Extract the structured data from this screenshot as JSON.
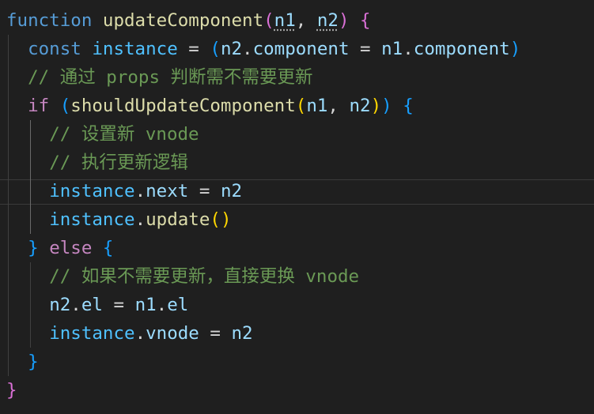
{
  "editor": {
    "background": "#1f1f1f",
    "lines": [
      [
        {
          "t": "function",
          "c": "kw"
        },
        {
          "t": " ",
          "c": "op"
        },
        {
          "t": "updateComponent",
          "c": "fn"
        },
        {
          "t": "(",
          "c": "b2"
        },
        {
          "t": "n1",
          "c": "var unused"
        },
        {
          "t": ", ",
          "c": "op"
        },
        {
          "t": "n2",
          "c": "var unused"
        },
        {
          "t": ")",
          "c": "b2"
        },
        {
          "t": " ",
          "c": "op"
        },
        {
          "t": "{",
          "c": "b2"
        }
      ],
      [
        {
          "t": "  ",
          "c": "op"
        },
        {
          "t": "const",
          "c": "kw"
        },
        {
          "t": " ",
          "c": "op"
        },
        {
          "t": "instance",
          "c": "cst"
        },
        {
          "t": " = ",
          "c": "op"
        },
        {
          "t": "(",
          "c": "b3"
        },
        {
          "t": "n2",
          "c": "var"
        },
        {
          "t": ".",
          "c": "op"
        },
        {
          "t": "component",
          "c": "var"
        },
        {
          "t": " = ",
          "c": "op"
        },
        {
          "t": "n1",
          "c": "var"
        },
        {
          "t": ".",
          "c": "op"
        },
        {
          "t": "component",
          "c": "var"
        },
        {
          "t": ")",
          "c": "b3"
        }
      ],
      [
        {
          "t": "  ",
          "c": "op"
        },
        {
          "t": "// 通过 props 判断需不需要更新",
          "c": "cm"
        }
      ],
      [
        {
          "t": "  ",
          "c": "op"
        },
        {
          "t": "if",
          "c": "ctl"
        },
        {
          "t": " ",
          "c": "op"
        },
        {
          "t": "(",
          "c": "b3"
        },
        {
          "t": "shouldUpdateComponent",
          "c": "fn"
        },
        {
          "t": "(",
          "c": "b1"
        },
        {
          "t": "n1",
          "c": "var"
        },
        {
          "t": ", ",
          "c": "op"
        },
        {
          "t": "n2",
          "c": "var"
        },
        {
          "t": ")",
          "c": "b1"
        },
        {
          "t": ")",
          "c": "b3"
        },
        {
          "t": " ",
          "c": "op"
        },
        {
          "t": "{",
          "c": "b3"
        }
      ],
      [
        {
          "t": "    ",
          "c": "op"
        },
        {
          "t": "// 设置新 vnode",
          "c": "cm"
        }
      ],
      [
        {
          "t": "    ",
          "c": "op"
        },
        {
          "t": "// 执行更新逻辑",
          "c": "cm"
        }
      ],
      [
        {
          "t": "    ",
          "c": "op"
        },
        {
          "t": "instance",
          "c": "cst"
        },
        {
          "t": ".",
          "c": "op"
        },
        {
          "t": "next",
          "c": "var"
        },
        {
          "t": " = ",
          "c": "op"
        },
        {
          "t": "n2",
          "c": "var"
        }
      ],
      [
        {
          "t": "    ",
          "c": "op"
        },
        {
          "t": "instance",
          "c": "cst"
        },
        {
          "t": ".",
          "c": "op"
        },
        {
          "t": "update",
          "c": "fn"
        },
        {
          "t": "(",
          "c": "b1"
        },
        {
          "t": ")",
          "c": "b1"
        }
      ],
      [
        {
          "t": "  ",
          "c": "op"
        },
        {
          "t": "}",
          "c": "b3"
        },
        {
          "t": " ",
          "c": "op"
        },
        {
          "t": "else",
          "c": "ctl"
        },
        {
          "t": " ",
          "c": "op"
        },
        {
          "t": "{",
          "c": "b3"
        }
      ],
      [
        {
          "t": "    ",
          "c": "op"
        },
        {
          "t": "// 如果不需要更新，直接更换 vnode",
          "c": "cm"
        }
      ],
      [
        {
          "t": "    ",
          "c": "op"
        },
        {
          "t": "n2",
          "c": "var"
        },
        {
          "t": ".",
          "c": "op"
        },
        {
          "t": "el",
          "c": "var"
        },
        {
          "t": " = ",
          "c": "op"
        },
        {
          "t": "n1",
          "c": "var"
        },
        {
          "t": ".",
          "c": "op"
        },
        {
          "t": "el",
          "c": "var"
        }
      ],
      [
        {
          "t": "    ",
          "c": "op"
        },
        {
          "t": "instance",
          "c": "cst"
        },
        {
          "t": ".",
          "c": "op"
        },
        {
          "t": "vnode",
          "c": "var"
        },
        {
          "t": " = ",
          "c": "op"
        },
        {
          "t": "n2",
          "c": "var"
        }
      ],
      [
        {
          "t": "  ",
          "c": "op"
        },
        {
          "t": "}",
          "c": "b3"
        }
      ],
      [
        {
          "t": "}",
          "c": "b2"
        }
      ]
    ]
  }
}
